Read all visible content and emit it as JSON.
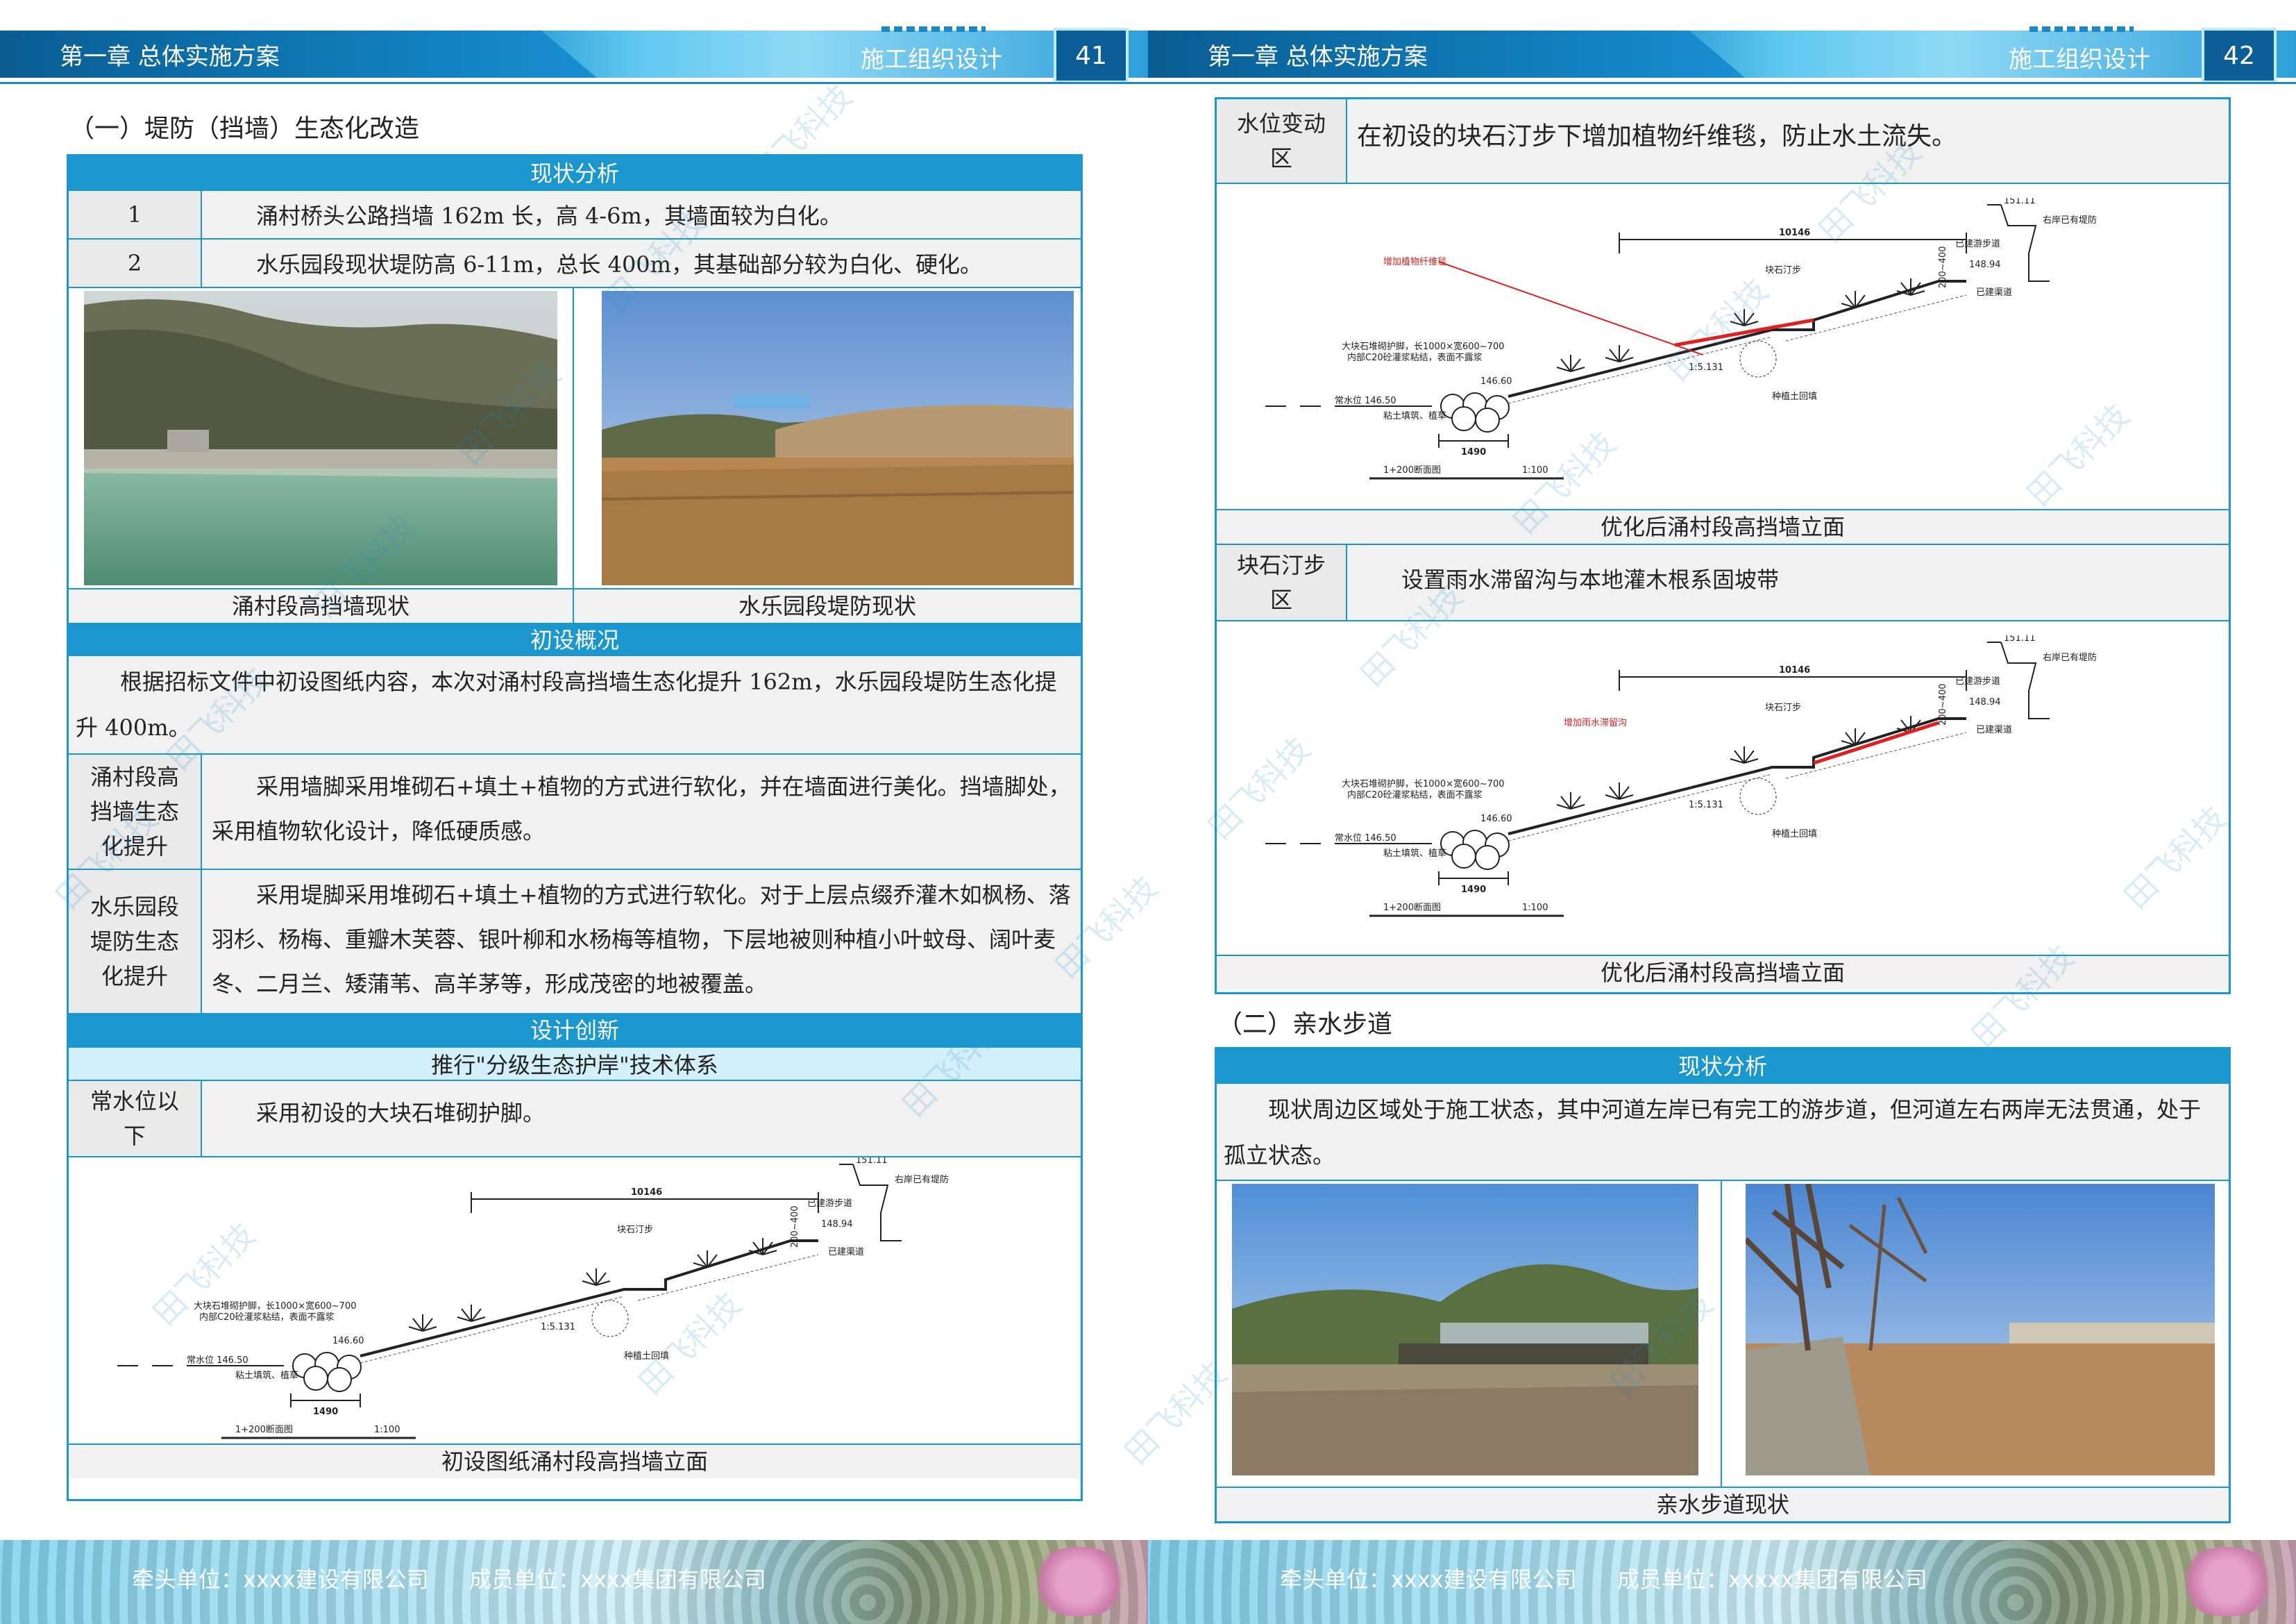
{
  "header": {
    "chapter": "第一章  总体实施方案",
    "section": "施工组织设计",
    "page_left": "41",
    "page_right": "42"
  },
  "footer": {
    "lead_unit": "牵头单位：xxxx建设有限公司",
    "member_unit_left": "成员单位：xxxx集团有限公司",
    "member_unit_right": "成员单位：xxxxx集团有限公司"
  },
  "watermark": "田飞科技",
  "left": {
    "title": "（一）堤防（挡墙）生态化改造",
    "status_bar": "现状分析",
    "status_rows": [
      {
        "no": "1",
        "text": "涌村桥头公路挡墙 162m 长，高 4-6m，其墙面较为白化。"
      },
      {
        "no": "2",
        "text": "水乐园段现状堤防高 6-11m，总长 400m，其基础部分较为白化、硬化。"
      }
    ],
    "photo_captions": [
      "涌村段高挡墙现状",
      "水乐园段堤防现状"
    ],
    "prelim_bar": "初设概况",
    "prelim_text": "根据招标文件中初设图纸内容，本次对涌村段高挡墙生态化提升 162m，水乐园段堤防生态化提升 400m。",
    "prelim_rows": [
      {
        "label": "涌村段高挡墙生态化提升",
        "text": "采用墙脚采用堆砌石+填土+植物的方式进行软化，并在墙面进行美化。挡墙脚处，采用植物软化设计，降低硬质感。"
      },
      {
        "label": "水乐园段堤防生态化提升",
        "text": "采用堤脚采用堆砌石+填土+植物的方式进行软化。对于上层点缀乔灌木如枫杨、落羽杉、杨梅、重瓣木芙蓉、银叶柳和水杨梅等植物，下层地被则种植小叶蚊母、阔叶麦冬、二月兰、矮蒲苇、高羊茅等，形成茂密的地被覆盖。"
      }
    ],
    "design_bar": "设计创新",
    "design_sub": "推行\"分级生态护岸\"技术体系",
    "design_rows": [
      {
        "label": "常水位以下",
        "text": "采用初设的大块石堆砌护脚。"
      }
    ],
    "drawing_caption": "初设图纸涌村段高挡墙立面"
  },
  "right": {
    "rows": [
      {
        "label": "水位变动区",
        "text": "在初设的块石汀步下增加植物纤维毯，防止水土流失。"
      },
      {
        "label": "块石汀步区",
        "text": "设置雨水滞留沟与本地灌木根系固坡带"
      }
    ],
    "drawing_captions": [
      "优化后涌村段高挡墙立面",
      "优化后涌村段高挡墙立面"
    ],
    "drawing_notes": [
      "增加植物纤维毯",
      "增加雨水滞留沟"
    ],
    "title2": "（二）亲水步道",
    "status_bar": "现状分析",
    "status_text": "现状周边区域处于施工状态，其中河道左岸已有完工的游步道，但河道左右两岸无法贯通，处于孤立状态。",
    "photo_caption": "亲水步道现状"
  },
  "drawing": {
    "dim_top": "10146",
    "dim_bottom": "1490",
    "elev_top": "151.11",
    "elev_mid": "148.94",
    "elev_low": "146.60",
    "elev_water": "常水位 146.50",
    "label_step": "块石汀步",
    "label_right_bank": "右岸已有堤防",
    "label_walk": "已建游步道",
    "label_channel": "已建渠道",
    "label_stone": "大块石堆砌护脚，长1000×宽600~700",
    "label_stone2": "内部C20砼灌浆粘结，表面不露浆",
    "label_fill": "种植土回填",
    "label_soil": "粘土填筑、植草",
    "label_slope": "1:5.131",
    "label_height": "200~400",
    "section_name": "1+200断面图",
    "scale": "1:100"
  }
}
